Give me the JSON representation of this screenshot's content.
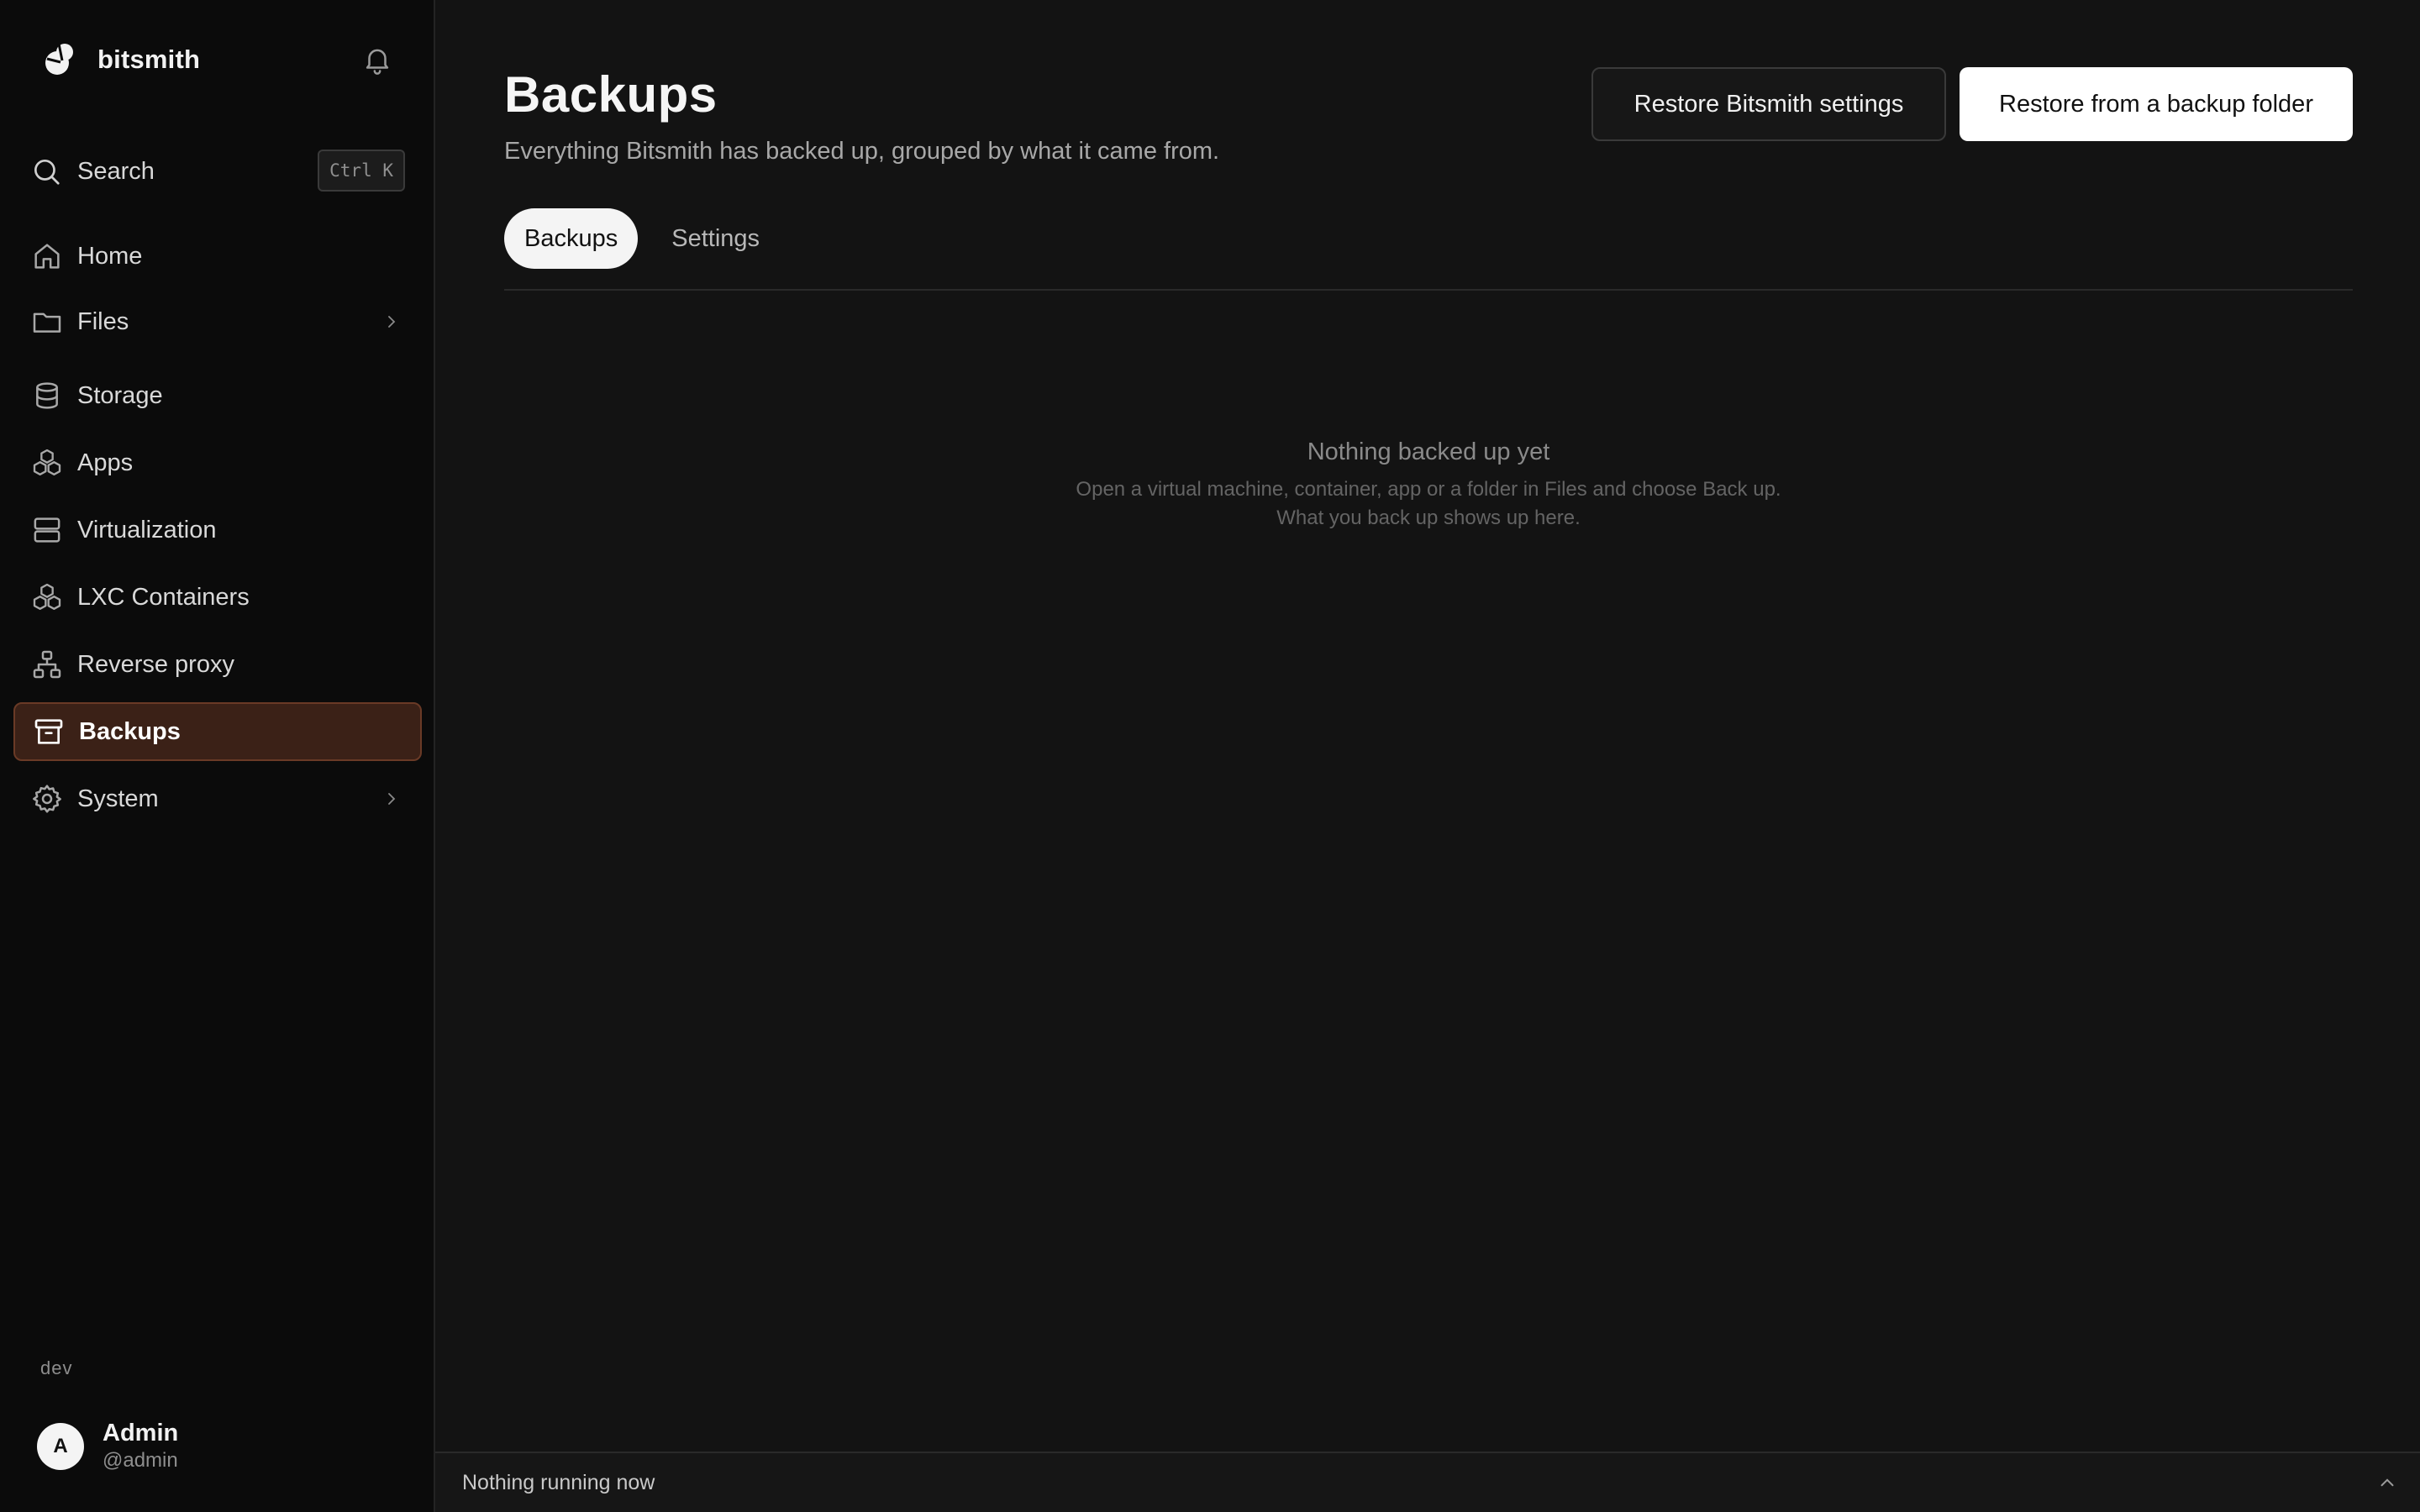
{
  "brand": {
    "name": "bitsmith"
  },
  "search": {
    "label": "Search",
    "shortcut": "Ctrl K"
  },
  "sidebar": {
    "items": [
      {
        "label": "Home",
        "icon": "home-icon"
      },
      {
        "label": "Files",
        "icon": "folder-icon",
        "expandable": true
      },
      {
        "label": "Storage",
        "icon": "database-icon"
      },
      {
        "label": "Apps",
        "icon": "boxes-icon"
      },
      {
        "label": "Virtualization",
        "icon": "server-icon"
      },
      {
        "label": "LXC Containers",
        "icon": "boxes-icon"
      },
      {
        "label": "Reverse proxy",
        "icon": "network-icon"
      },
      {
        "label": "Backups",
        "icon": "archive-icon",
        "active": true
      },
      {
        "label": "System",
        "icon": "gear-icon",
        "expandable": true
      }
    ],
    "env": "dev"
  },
  "user": {
    "initial": "A",
    "name": "Admin",
    "handle": "@admin"
  },
  "page": {
    "title": "Backups",
    "subtitle": "Everything Bitsmith has backed up, grouped by what it came from.",
    "secondary_button": "Restore Bitsmith settings",
    "primary_button": "Restore from a backup folder"
  },
  "tabs": [
    {
      "label": "Backups",
      "active": true
    },
    {
      "label": "Settings",
      "active": false
    }
  ],
  "empty_state": {
    "title": "Nothing backed up yet",
    "line1": "Open a virtual machine, container, app or a folder in Files and choose Back up.",
    "line2": "What you back up shows up here."
  },
  "statusbar": {
    "text": "Nothing running now"
  },
  "colors": {
    "accent_bg": "#3b2117",
    "accent_border": "#6a3a26",
    "background": "#131313",
    "sidebar": "#0b0b0b"
  }
}
